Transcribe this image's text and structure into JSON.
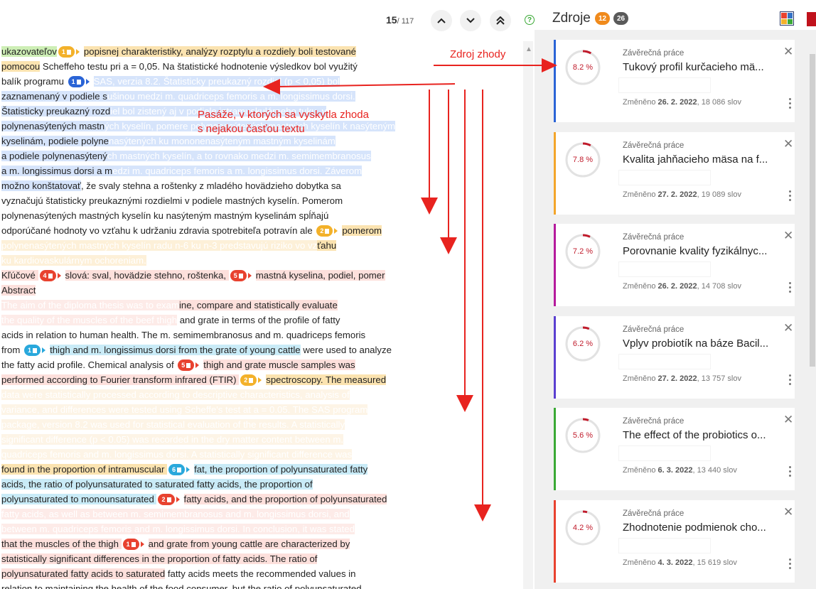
{
  "toolbar": {
    "counter_current": "15",
    "counter_total": "/ 117",
    "help_label": "?"
  },
  "sources_header": {
    "title": "Zdroje",
    "badge_orange": "12",
    "badge_dark": "26",
    "colors": {
      "orange": "#f08a1c",
      "dark": "#5a5a5a"
    }
  },
  "annotations": {
    "match_source": "Zdroj zhody",
    "passages_line1": "Pasáže, v ktorých sa vyskytla zhoda",
    "passages_line2": "s nejakou časťou textu"
  },
  "doc_lines": [
    {
      "segs": [
        {
          "t": "ukazovateľov",
          "bg": "#cdeeb5"
        },
        {
          "m": "1",
          "c": "#f3b12a"
        },
        {
          "t": "popisnej charakteristiky, analýzy rozptylu a rozdiely boli testované",
          "bg": "#fbe3b0"
        }
      ]
    },
    {
      "segs": [
        {
          "t": "pomocou",
          "bg": "#fbe3b0"
        },
        {
          "t": " Scheffeho testu pri a = 0,05. Na štatistické hodnotenie výsledkov bol využitý",
          "bg": ""
        }
      ]
    },
    {
      "segs": [
        {
          "t": "balík programu ",
          "bg": ""
        },
        {
          "m": "1",
          "c": "#2a64d6"
        },
        {
          "t": "SAS, verzia 8.2. Štatisticky preukazný rozdiel (p < 0,05) bol",
          "bg": "#d6e4fb",
          "f": 1
        }
      ]
    },
    {
      "segs": [
        {
          "t": "zaznamenaný v podiele s",
          "bg": "#d6e4fb"
        },
        {
          "t": "ušinou medzi m. quadriceps femoris a m. longissimus dorsi.",
          "bg": "#d6e4fb",
          "f": 1
        }
      ]
    },
    {
      "segs": [
        {
          "t": "Štatisticky preukazný rozd",
          "bg": "#d6e4fb"
        },
        {
          "t": "iel bol zistený aj v podiele intramuskulárneho tuku, v",
          "bg": "#d6e4fb",
          "f": 1
        }
      ]
    },
    {
      "segs": [
        {
          "t": "polynenasýtených mastn",
          "bg": "#d6e4fb"
        },
        {
          "t": "ých kyselín, pomere polynenasýtených mastných kyselín k nasýteným",
          "bg": "#d6e4fb",
          "f": 1
        }
      ]
    },
    {
      "segs": [
        {
          "t": "kyselinám, podiele polyne",
          "bg": "#d6e4fb"
        },
        {
          "t": "nasýtených ku mononenasýteným mastným kyselinám",
          "bg": "#d6e4fb",
          "f": 1
        }
      ]
    },
    {
      "segs": [
        {
          "t": "a podiele polynenasýtený",
          "bg": "#d6e4fb"
        },
        {
          "t": "ch mastných kyselín, a to rovnako medzi m. semimembranosus",
          "bg": "#d6e4fb",
          "f": 1
        }
      ]
    },
    {
      "segs": [
        {
          "t": "a m. longissimus dorsi a m",
          "bg": "#d6e4fb"
        },
        {
          "t": "edzi m. quadriceps femoris a m. longissimus dorsi. Záverom",
          "bg": "#d6e4fb",
          "f": 1
        }
      ]
    },
    {
      "segs": [
        {
          "t": "možno konštatovať",
          "bg": "#d6e4fb"
        },
        {
          "t": ", že svaly stehna a roštenky z mladého hovädzieho dobytka sa",
          "bg": ""
        }
      ]
    },
    {
      "segs": [
        {
          "t": "vyznačujú štatisticky preukaznými rozdielmi v podiele mastných kyselín. Pomerom",
          "bg": ""
        }
      ]
    },
    {
      "segs": [
        {
          "t": "polynenasýtených mastných kyselín ku nasýteným mastným kyselinám spĺňajú",
          "bg": ""
        }
      ]
    },
    {
      "segs": [
        {
          "t": "odporúčané hodnoty vo vzťahu k udržaniu zdravia spotrebiteľa potravín ale ",
          "bg": ""
        },
        {
          "m": "2",
          "c": "#f3b12a"
        },
        {
          "t": "pomerom",
          "bg": "#fbe3b0"
        }
      ]
    },
    {
      "segs": [
        {
          "t": "polynenasýtených mastných kyselín radu n-6 ku n-3 predstavujú riziko vo vz",
          "bg": "#fdf0d8",
          "f": 1
        },
        {
          "t": "ťahu",
          "bg": "#fbe3b0"
        }
      ]
    },
    {
      "segs": [
        {
          "t": "ku kardiovaskulárnym ochoreniam.",
          "bg": "#fdf0d8",
          "f": 1
        }
      ]
    },
    {
      "segs": [
        {
          "t": "Kľúčové ",
          "bg": "#fde0dc"
        },
        {
          "m": "4",
          "c": "#e8422f"
        },
        {
          "t": "slová: sval, hovädzie stehno, roštenka, ",
          "bg": "#fde0dc"
        },
        {
          "m": "5",
          "c": "#e8422f"
        },
        {
          "t": "mastná kyselina, podiel, pomer",
          "bg": "#fde0dc"
        }
      ]
    },
    {
      "segs": [
        {
          "t": "Abstract",
          "bg": "#fde0dc"
        }
      ]
    },
    {
      "segs": [
        {
          "t": "The aim of the diploma thesis was to exam",
          "bg": "#fdebe8",
          "f": 1
        },
        {
          "t": "ine, compare and statistically evaluate",
          "bg": "#fde0dc"
        }
      ]
    },
    {
      "segs": [
        {
          "t": "the quality of the muscles of the beef thigh",
          "bg": "#fdebe8",
          "f": 1
        },
        {
          "t": " and grate in terms of the profile of fatty",
          "bg": ""
        }
      ]
    },
    {
      "segs": [
        {
          "t": "acids in relation to human health. The m. semimembranosus and m. quadriceps femoris",
          "bg": ""
        }
      ]
    },
    {
      "segs": [
        {
          "t": "from ",
          "bg": ""
        },
        {
          "m": "1",
          "c": "#29a8dc"
        },
        {
          "t": "thigh and m. longissimus dorsi from the grate of young cattle",
          "bg": "#c9ebf7"
        },
        {
          "t": " were used to analyze",
          "bg": ""
        }
      ]
    },
    {
      "segs": [
        {
          "t": "the fatty acid profile. Chemical analysis of ",
          "bg": ""
        },
        {
          "m": "5",
          "c": "#e8422f"
        },
        {
          "t": "thigh and grate muscle samples was",
          "bg": "#fde0dc"
        }
      ]
    },
    {
      "segs": [
        {
          "t": "performed according to Fourier transform infrared (FTIR) ",
          "bg": "#fde0dc"
        },
        {
          "m": "2",
          "c": "#f3b12a"
        },
        {
          "t": "spectroscopy. The measured",
          "bg": "#fbe3b0"
        }
      ]
    },
    {
      "segs": [
        {
          "t": "data were statistically processed according to descriptive characteristics, analysis of",
          "bg": "#fdf4e6",
          "f": 1
        }
      ]
    },
    {
      "segs": [
        {
          "t": "variance, and differences were tested using Scheffe's test at a = 0.05. The SAS program",
          "bg": "#fdf4e6",
          "f": 1
        }
      ]
    },
    {
      "segs": [
        {
          "t": "package, version 8.2 was used for statistical evaluation of the results. A statistically",
          "bg": "#fdf4e6",
          "f": 1
        }
      ]
    },
    {
      "segs": [
        {
          "t": "significant difference (p < 0.05) was recorded in the dry matter content between m.",
          "bg": "#fdf4e6",
          "f": 1
        }
      ]
    },
    {
      "segs": [
        {
          "t": "quadriceps femoris and m. longissimus dorsi. A statistically significant difference was",
          "bg": "#fdf4e6",
          "f": 1
        }
      ]
    },
    {
      "segs": [
        {
          "t": "found in the proportion of intramuscular ",
          "bg": "#fbe3b0"
        },
        {
          "m": "6",
          "c": "#29a8dc"
        },
        {
          "t": "fat, the proportion of polyunsaturated fatty",
          "bg": "#c9ebf7"
        }
      ]
    },
    {
      "segs": [
        {
          "t": "acids, the ratio of polyunsaturated to saturated fatty acids, the proportion of",
          "bg": "#c9ebf7"
        }
      ]
    },
    {
      "segs": [
        {
          "t": "polyunsaturated to monounsaturated ",
          "bg": "#c9ebf7"
        },
        {
          "m": "2",
          "c": "#e8422f"
        },
        {
          "t": "fatty acids, and the proportion of polyunsaturated",
          "bg": "#fde0dc"
        }
      ]
    },
    {
      "segs": [
        {
          "t": "fatty acids, as well as between m. semimembranosus and m. longissimus dorsi, and",
          "bg": "#fdebe8",
          "f": 1
        }
      ]
    },
    {
      "segs": [
        {
          "t": "between m. quadriceps femoris and m. longissimus dorsi. In conclusion, it was stated",
          "bg": "#fdebe8",
          "f": 1
        }
      ]
    },
    {
      "segs": [
        {
          "t": "that the muscles of the thigh ",
          "bg": "#fde0dc"
        },
        {
          "m": "1",
          "c": "#e8422f"
        },
        {
          "t": "and grate from young cattle are characterized by",
          "bg": "#fde0dc"
        }
      ]
    },
    {
      "segs": [
        {
          "t": "statistically significant differences in the proportion of fatty acids. The ratio of",
          "bg": "#fde0dc"
        }
      ]
    },
    {
      "segs": [
        {
          "t": "polyunsaturated fatty acids to saturated",
          "bg": "#fde0dc"
        },
        {
          "t": " fatty acids meets the recommended values in",
          "bg": ""
        }
      ]
    },
    {
      "segs": [
        {
          "t": "relation to maintaining the health of the food consumer, but the ratio of polyunsaturated",
          "bg": ""
        }
      ]
    }
  ],
  "sources": [
    {
      "kind": "Závěrečná práce",
      "title": "Tukový profil kurčacieho mä...",
      "percent": "8.2 %",
      "pct_value": 8.2,
      "changed_label": "Změněno",
      "date": "26. 2. 2022",
      "words": ", 18 086 slov",
      "color": "#2a64d6",
      "close": "✕"
    },
    {
      "kind": "Závěrečná práce",
      "title": "Kvalita jahňacieho mäsa na f...",
      "percent": "7.8 %",
      "pct_value": 7.8,
      "changed_label": "Změněno",
      "date": "27. 2. 2022",
      "words": ", 19 089 slov",
      "color": "#f3a52a",
      "close": "✕"
    },
    {
      "kind": "Závěrečná práce",
      "title": "Porovnanie kvality fyzikálnyc...",
      "percent": "7.2 %",
      "pct_value": 7.2,
      "changed_label": "Změněno",
      "date": "26. 2. 2022",
      "words": ", 14 708 slov",
      "color": "#b51a9c",
      "close": "✕"
    },
    {
      "kind": "Závěrečná práce",
      "title": "Vplyv probiotík na báze Bacil...",
      "percent": "6.2 %",
      "pct_value": 6.2,
      "changed_label": "Změněno",
      "date": "27. 2. 2022",
      "words": ", 13 757 slov",
      "color": "#5a3fd0",
      "close": "✕"
    },
    {
      "kind": "Závěrečná práce",
      "title": "The effect of the probiotics o...",
      "percent": "5.6 %",
      "pct_value": 5.6,
      "changed_label": "Změněno",
      "date": "6. 3. 2022",
      "words": ", 13 440 slov",
      "color": "#3aa935",
      "close": "✕"
    },
    {
      "kind": "Závěrečná práce",
      "title": "Zhodnotenie podmienok cho...",
      "percent": "4.2 %",
      "pct_value": 4.2,
      "changed_label": "Změněno",
      "date": "4. 3. 2022",
      "words": ", 15 619 slov",
      "color": "#e8422f",
      "close": "✕"
    }
  ]
}
